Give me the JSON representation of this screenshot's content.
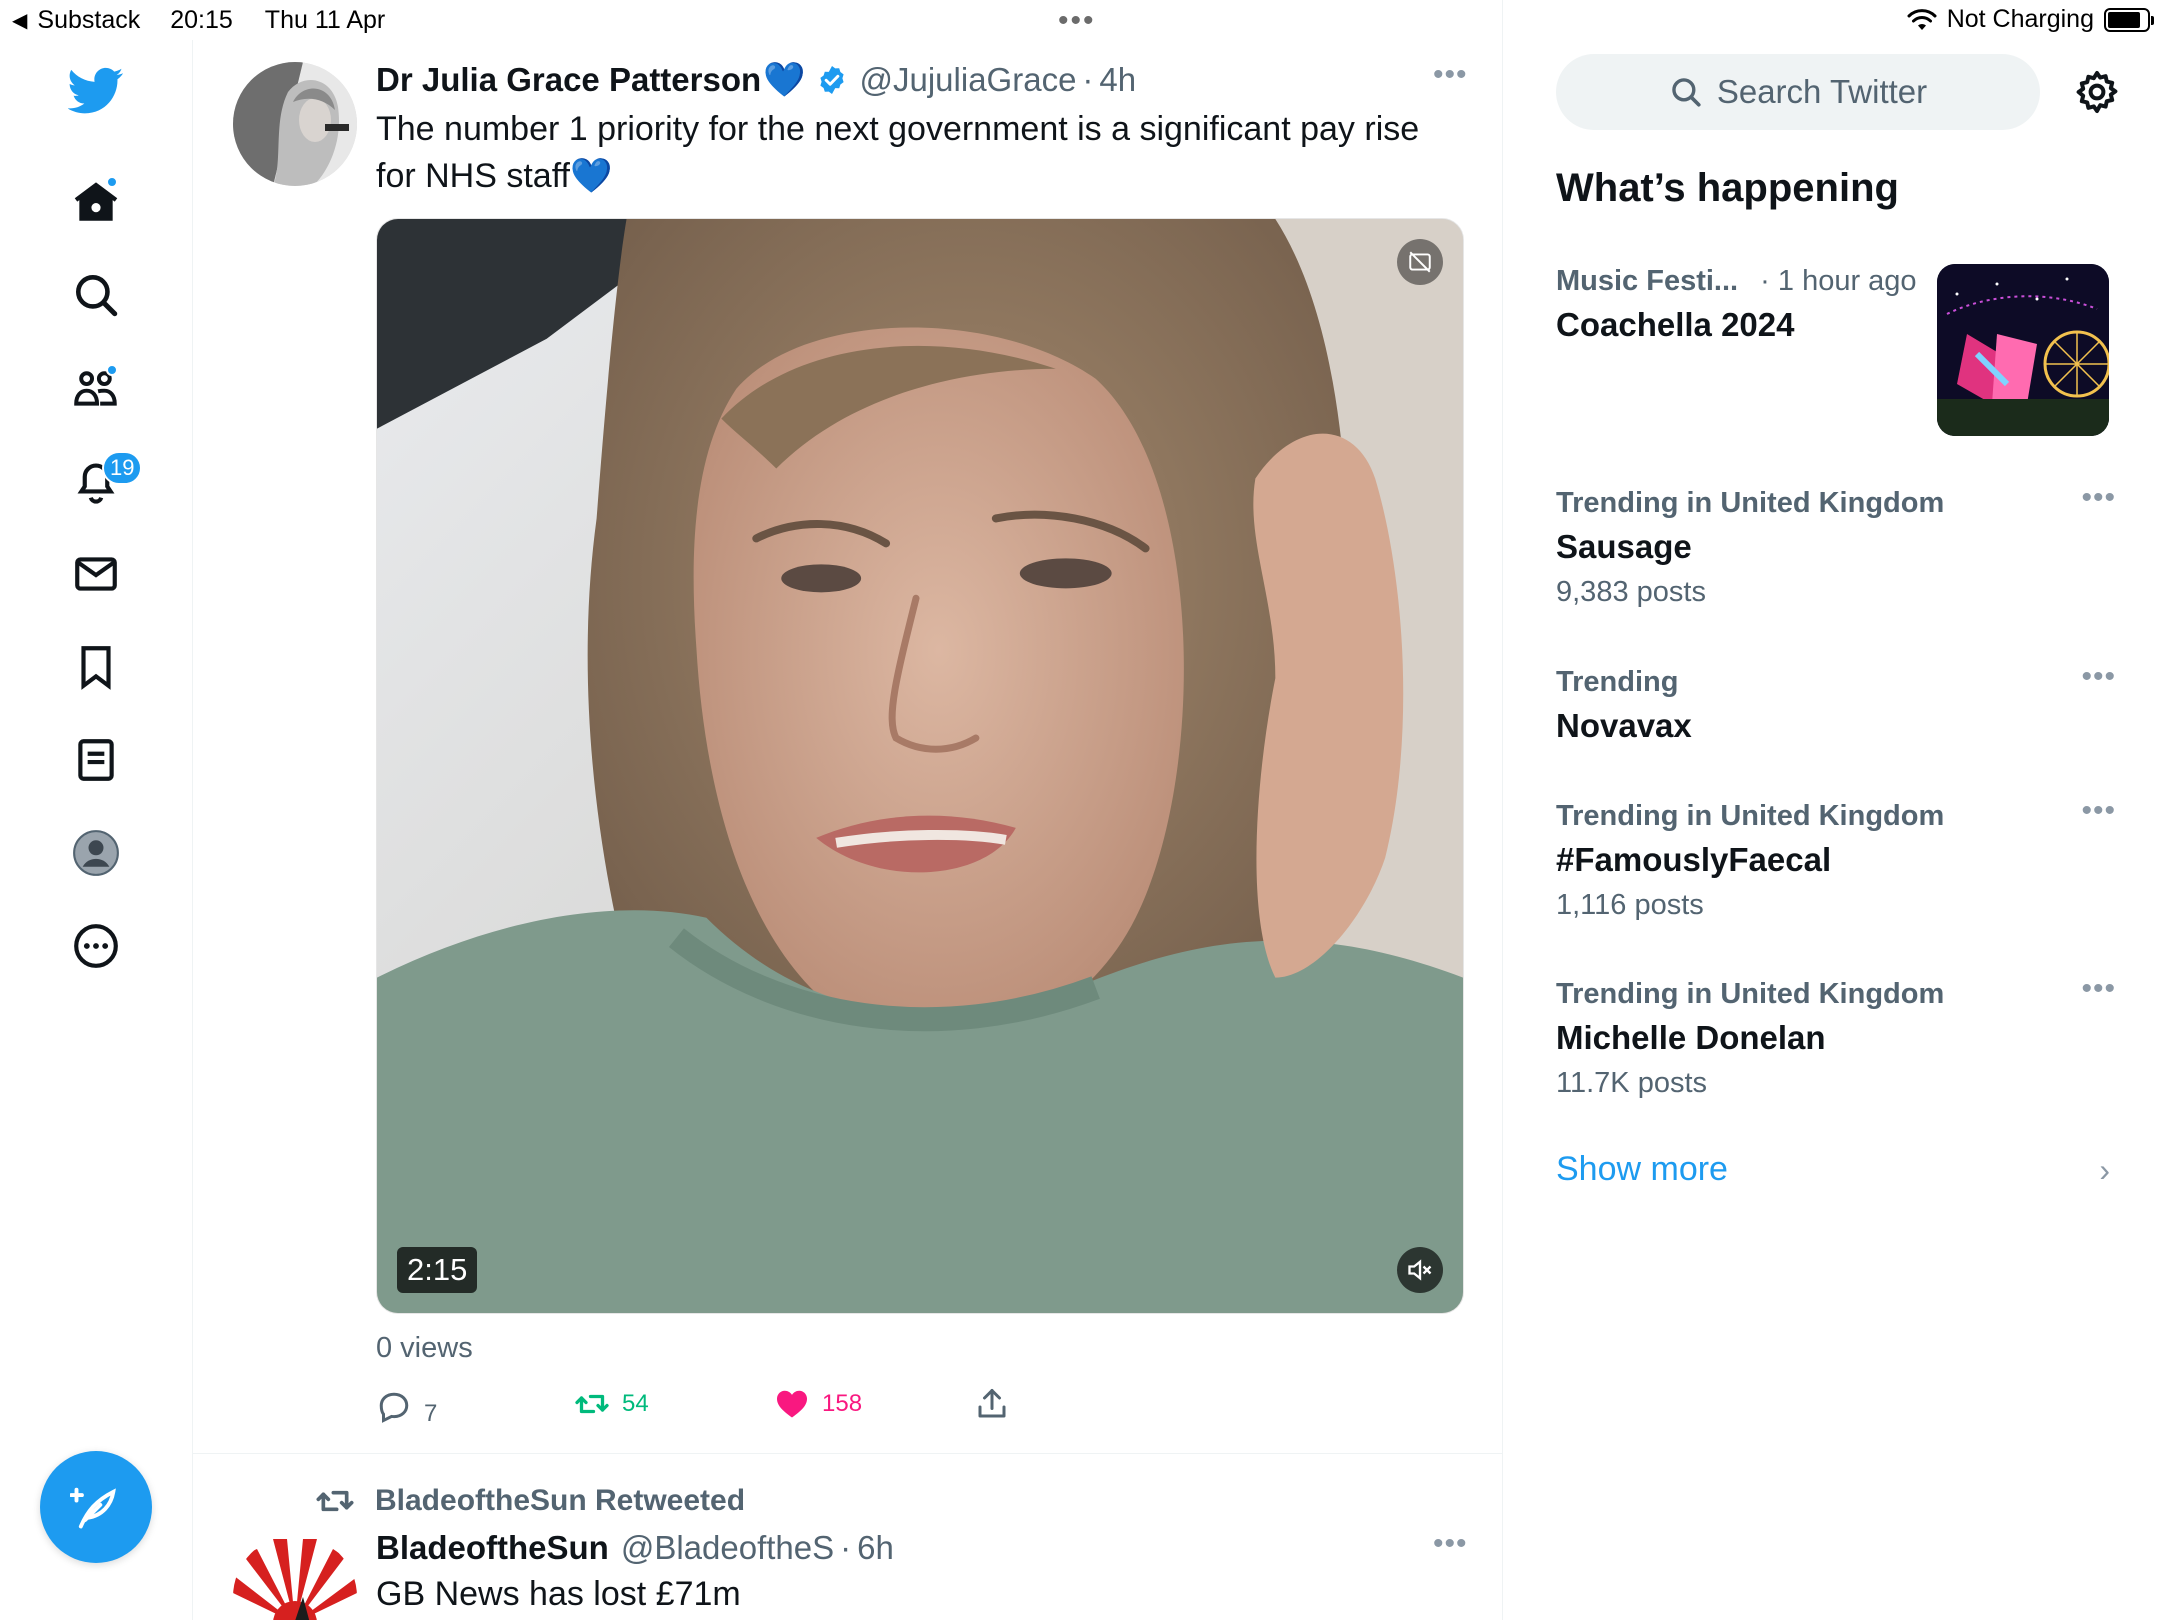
{
  "status_bar": {
    "back_app": "Substack",
    "time": "20:15",
    "date": "Thu 11 Apr",
    "multitask_dots": "•••",
    "battery_status": "Not Charging"
  },
  "nav": {
    "notifications_count": "19",
    "items": [
      "home-icon",
      "search-icon",
      "communities-icon",
      "notifications-icon",
      "messages-icon",
      "bookmarks-icon",
      "lists-icon",
      "profile-icon",
      "more-icon"
    ]
  },
  "tweet1": {
    "author_name": "Dr Julia Grace Patterson",
    "author_emoji": "💙",
    "handle": "@JujuliaGrace",
    "separator": "·",
    "time_ago": "4h",
    "more": "•••",
    "text": "The number 1 priority for the next government is a significant pay rise for NHS staff",
    "text_emoji": "💙",
    "video_duration": "2:15",
    "views": "0 views",
    "replies": "7",
    "retweets": "54",
    "likes": "158"
  },
  "tweet2": {
    "retweeted_by": "BladeoftheSun Retweeted",
    "author_name": "BladeoftheSun",
    "handle": "@BladeoftheS",
    "separator": "·",
    "time_ago": "6h",
    "more": "•••",
    "text": "GB News has lost £71m"
  },
  "sidebar": {
    "search_placeholder": "Search Twitter",
    "whats_happening": "What’s happening",
    "trends": [
      {
        "context": "Music Festi...",
        "context_time": "· 1 hour ago",
        "topic": "Coachella 2024",
        "count": ""
      },
      {
        "context": "Trending in United Kingdom",
        "topic": "Sausage",
        "count": "9,383 posts"
      },
      {
        "context": "Trending",
        "topic": "Novavax",
        "count": ""
      },
      {
        "context": "Trending in United Kingdom",
        "topic": "#FamouslyFaecal",
        "count": "1,116 posts"
      },
      {
        "context": "Trending in United Kingdom",
        "topic": "Michelle Donelan",
        "count": "11.7K posts"
      }
    ],
    "trend_more": "•••",
    "show_more": "Show more",
    "show_more_chevron": "›"
  },
  "colors": {
    "accent": "#1d9bf0",
    "retweet": "#00ba7c",
    "like": "#f91880",
    "secondary_text": "#536471"
  }
}
